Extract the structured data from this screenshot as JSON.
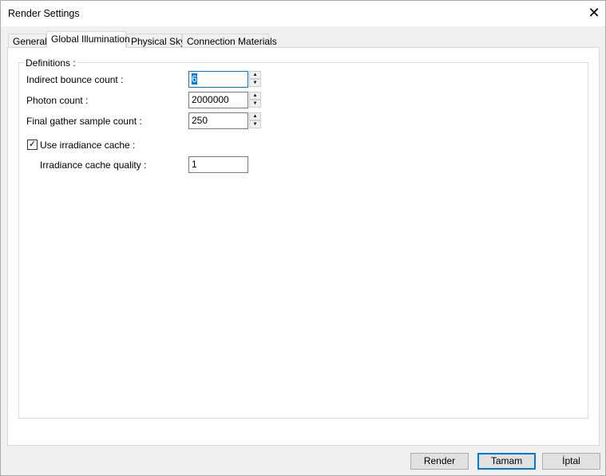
{
  "window": {
    "title": "Render Settings",
    "close_icon": "close-icon"
  },
  "tabs": [
    {
      "label": "General"
    },
    {
      "label": "Global Illumination",
      "active": true
    },
    {
      "label": "Physical Sky"
    },
    {
      "label": "Connection Materials"
    }
  ],
  "group": {
    "label": "Definitions :"
  },
  "fields": {
    "indirect_bounce": {
      "label": "Indirect bounce count :",
      "value": "6"
    },
    "photon_count": {
      "label": "Photon count :",
      "value": "2000000"
    },
    "final_gather": {
      "label": "Final gather sample count :",
      "value": "250"
    },
    "use_irradiance": {
      "label": "Use irradiance cache :",
      "checked": true,
      "check": "✓"
    },
    "irradiance_quality": {
      "label": "Irradiance cache quality :",
      "value": "1"
    }
  },
  "spin": {
    "up": "▲",
    "down": "▼"
  },
  "buttons": {
    "render": "Render",
    "ok": "Tamam",
    "cancel": "İptal"
  }
}
